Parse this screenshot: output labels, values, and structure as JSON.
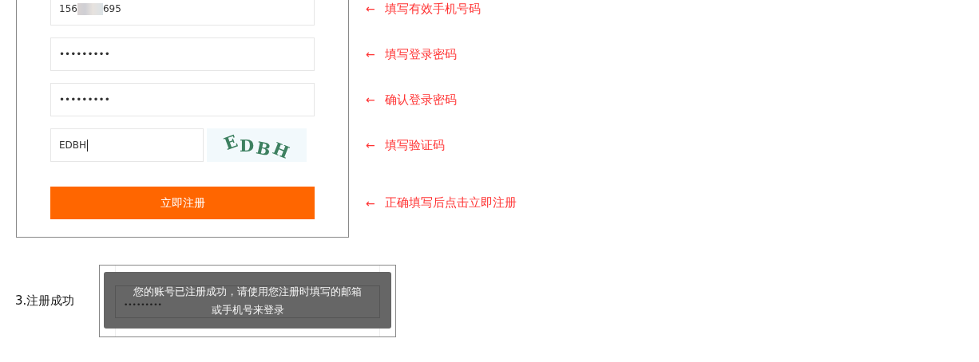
{
  "registration_form": {
    "fields": [
      {
        "kind": "phone",
        "value_start": "156",
        "value_end": "695"
      },
      {
        "kind": "password",
        "value": "•••••••••"
      },
      {
        "kind": "password",
        "value": "•••••••••"
      },
      {
        "kind": "captcha",
        "value": "EDBH",
        "captcha": "EDBH"
      }
    ],
    "submit_button": "立即注册"
  },
  "annotations": [
    {
      "arrow": "←",
      "text": "填写有效手机号码"
    },
    {
      "arrow": "←",
      "text": "填写登录密码"
    },
    {
      "arrow": "←",
      "text": "确认登录密码"
    },
    {
      "arrow": "←",
      "text": "填写验证码"
    },
    {
      "arrow": "←",
      "text": "正确填写后点击立即注册"
    }
  ],
  "step": {
    "label": "3.注册成功",
    "background_password": "•••••••••",
    "toast_lines": [
      "您的账号已注册成功，请使用您注册时填写的邮箱",
      "或手机号来登录"
    ]
  }
}
